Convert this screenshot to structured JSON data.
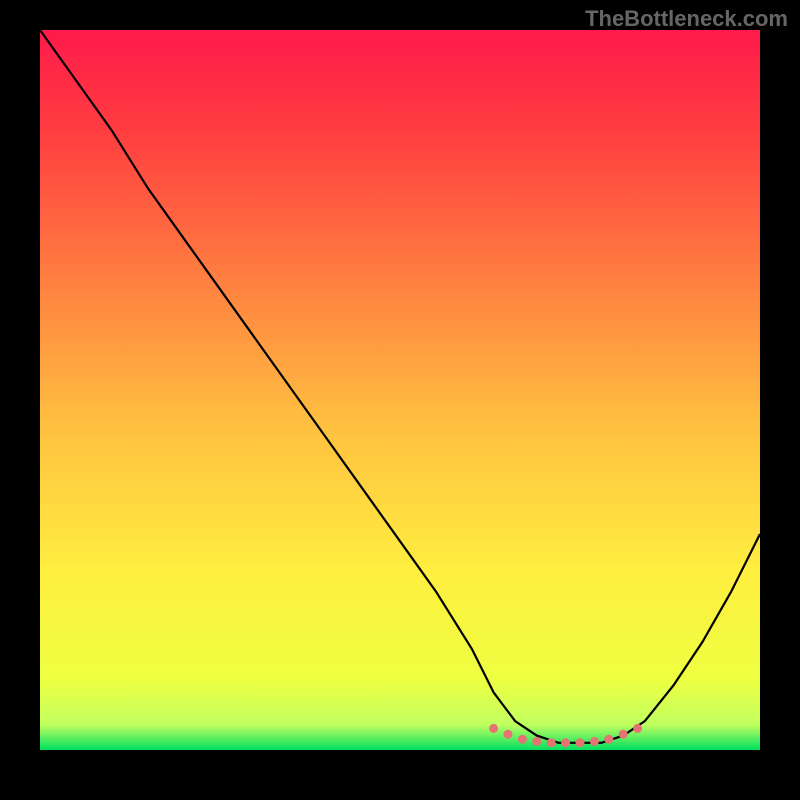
{
  "watermark": "TheBottleneck.com",
  "chart_data": {
    "type": "line",
    "title": "",
    "xlabel": "",
    "ylabel": "",
    "xlim": [
      0,
      100
    ],
    "ylim": [
      0,
      100
    ],
    "series": [
      {
        "name": "curve",
        "color": "#000000",
        "x": [
          0,
          5,
          10,
          15,
          20,
          25,
          30,
          35,
          40,
          45,
          50,
          55,
          60,
          63,
          66,
          69,
          72,
          75,
          78,
          81,
          84,
          88,
          92,
          96,
          100
        ],
        "y": [
          100,
          93,
          86,
          78,
          71,
          64,
          57,
          50,
          43,
          36,
          29,
          22,
          14,
          8,
          4,
          2,
          1,
          1,
          1,
          2,
          4,
          9,
          15,
          22,
          30
        ]
      },
      {
        "name": "bottom-dots",
        "color": "#e57373",
        "x": [
          63,
          65,
          67,
          69,
          71,
          73,
          75,
          77,
          79,
          81,
          83
        ],
        "y": [
          3,
          2.2,
          1.5,
          1.2,
          1,
          1,
          1,
          1.2,
          1.5,
          2.2,
          3
        ]
      }
    ],
    "background": {
      "type": "vertical-gradient",
      "stops": [
        {
          "offset": 0.0,
          "color": "#ff1a4b"
        },
        {
          "offset": 0.15,
          "color": "#ff4040"
        },
        {
          "offset": 0.35,
          "color": "#ff8040"
        },
        {
          "offset": 0.55,
          "color": "#ffc040"
        },
        {
          "offset": 0.75,
          "color": "#ffee40"
        },
        {
          "offset": 0.9,
          "color": "#eeff40"
        },
        {
          "offset": 0.965,
          "color": "#c0ff60"
        },
        {
          "offset": 1.0,
          "color": "#00e060"
        }
      ]
    }
  }
}
